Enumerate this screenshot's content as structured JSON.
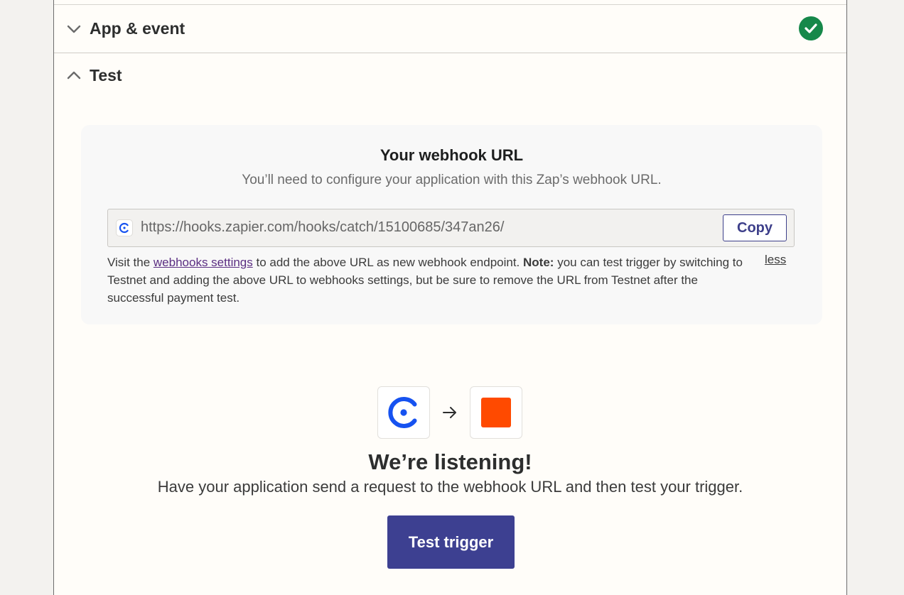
{
  "sections": {
    "app_event": {
      "title": "App & event",
      "status_icon": "check-icon",
      "status_color": "#16884a",
      "expanded": false
    },
    "test": {
      "title": "Test",
      "expanded": true
    }
  },
  "webhook_card": {
    "title": "Your webhook URL",
    "subtitle": "You’ll need to configure your application with this Zap’s webhook URL.",
    "url": "https://hooks.zapier.com/hooks/catch/15100685/347an26/",
    "copy_label": "Copy",
    "help": {
      "prefix": "Visit the ",
      "link_text": "webhooks settings",
      "middle": " to add the above URL as new webhook endpoint. ",
      "note_label": "Note:",
      "suffix": " you can test trigger by switching to Testnet and adding the above URL to webhooks settings, but be sure to remove the URL from Testnet after the successful payment test."
    },
    "less_label": "less"
  },
  "listening": {
    "source_icon": "coinbase-commerce-icon",
    "target_icon": "zapier-icon",
    "title": "We’re listening!",
    "subtitle": "Have your application send a request to the webhook URL and then test your trigger.",
    "button_label": "Test trigger"
  },
  "colors": {
    "accent": "#3d4091",
    "zapier_orange": "#ff4a00",
    "link": "#5b2e82"
  }
}
